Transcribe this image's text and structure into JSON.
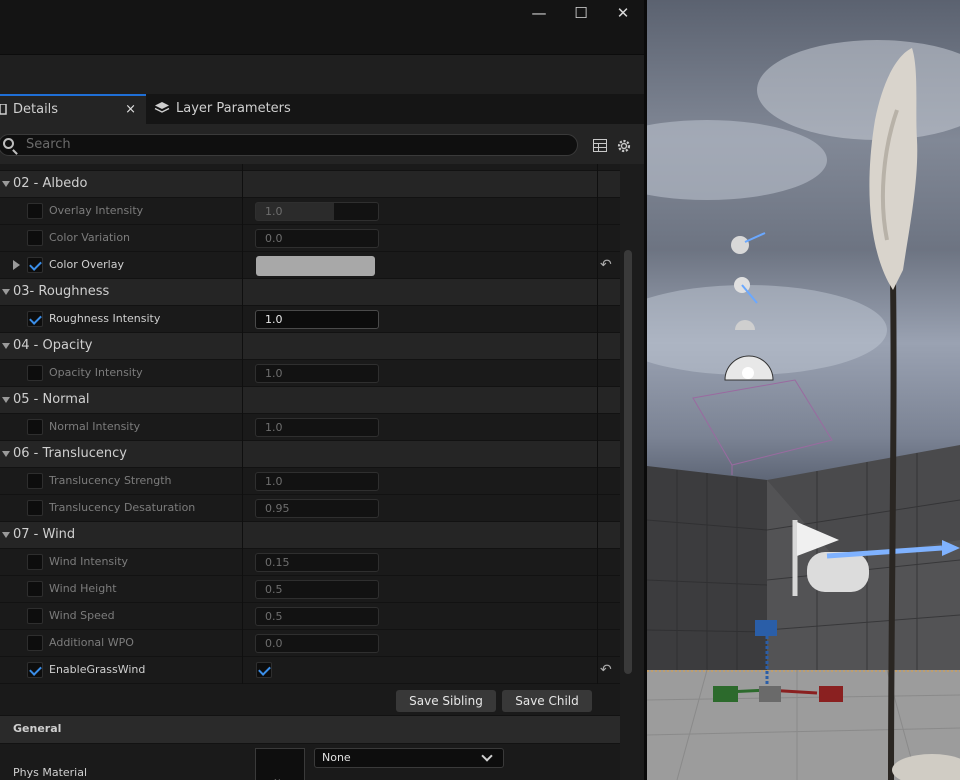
{
  "window": {
    "minimize": "—",
    "maximize": "☐",
    "close": "✕"
  },
  "tabs": {
    "details": "Details",
    "details_close": "×",
    "layer_params": "Layer Parameters"
  },
  "search": {
    "placeholder": "Search"
  },
  "rows": [
    {
      "type": "color-top"
    },
    {
      "type": "cat",
      "label": "02 - Albedo"
    },
    {
      "type": "prop",
      "label": "Overlay Intensity",
      "value": "1.0",
      "checked": false,
      "fill_fraction": 0.64
    },
    {
      "type": "prop",
      "label": "Color Variation",
      "value": "0.0",
      "checked": false
    },
    {
      "type": "color",
      "label": "Color Overlay",
      "checked": true,
      "color": "#a8a8a8"
    },
    {
      "type": "cat",
      "label": "03- Roughness"
    },
    {
      "type": "prop",
      "label": "Roughness Intensity",
      "value": "1.0",
      "checked": true
    },
    {
      "type": "cat",
      "label": "04 - Opacity"
    },
    {
      "type": "prop",
      "label": "Opacity Intensity",
      "value": "1.0",
      "checked": false
    },
    {
      "type": "cat",
      "label": "05 - Normal"
    },
    {
      "type": "prop",
      "label": "Normal Intensity",
      "value": "1.0",
      "checked": false
    },
    {
      "type": "cat",
      "label": "06 - Translucency"
    },
    {
      "type": "prop",
      "label": "Translucency Strength",
      "value": "1.0",
      "checked": false
    },
    {
      "type": "prop",
      "label": "Translucency Desaturation",
      "value": "0.95",
      "checked": false
    },
    {
      "type": "cat",
      "label": "07 - Wind"
    },
    {
      "type": "prop",
      "label": "Wind Intensity",
      "value": "0.15",
      "checked": false
    },
    {
      "type": "prop",
      "label": "Wind Height",
      "value": "0.5",
      "checked": false
    },
    {
      "type": "prop",
      "label": "Wind Speed",
      "value": "0.5",
      "checked": false
    },
    {
      "type": "prop",
      "label": "Additional WPO",
      "value": "0.0",
      "checked": false
    },
    {
      "type": "bool",
      "label": "EnableGrassWind",
      "checked": true
    }
  ],
  "buttons": {
    "save_sibling": "Save Sibling",
    "save_child": "Save Child"
  },
  "general": {
    "header": "General",
    "phys_label": "Phys Material",
    "phys_value": "None",
    "phys_thumb": "No"
  },
  "colors": {
    "accent": "#1f6fd6",
    "check": "#3b8ee8",
    "color_overlay": "#a8a8a8",
    "top_swatch": "#1fd81f"
  }
}
